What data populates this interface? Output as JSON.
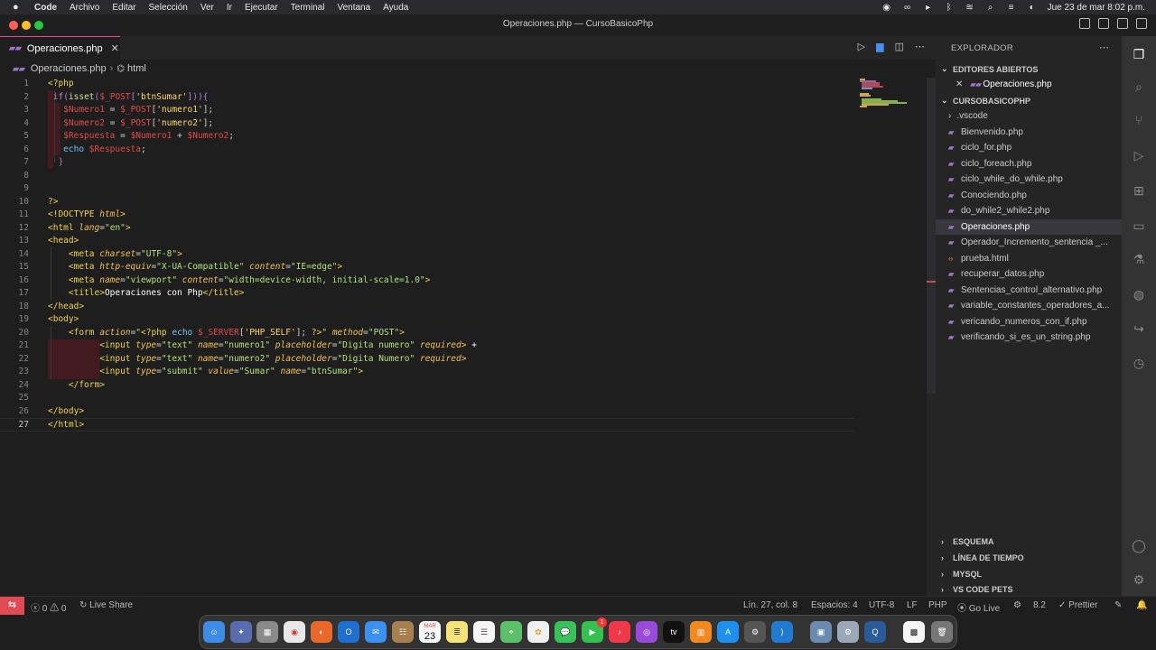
{
  "menubar": {
    "app": "Code",
    "items": [
      "Archivo",
      "Editar",
      "Selección",
      "Ver",
      "Ir",
      "Ejecutar",
      "Terminal",
      "Ventana",
      "Ayuda"
    ],
    "clock": "Jue 23 de mar  8:02 p.m."
  },
  "window": {
    "title": "Operaciones.php — CursoBasicoPhp"
  },
  "tab": {
    "label": "Operaciones.php",
    "close": "✕"
  },
  "breadcrumb": {
    "file": "Operaciones.php",
    "symbol": "html",
    "separator": "›"
  },
  "editor": {
    "current_line": 27,
    "lines": [
      {
        "n": "1"
      },
      {
        "n": "2"
      },
      {
        "n": "3"
      },
      {
        "n": "4"
      },
      {
        "n": "5"
      },
      {
        "n": "6"
      },
      {
        "n": "7"
      },
      {
        "n": "8"
      },
      {
        "n": "9"
      },
      {
        "n": "10"
      },
      {
        "n": "11"
      },
      {
        "n": "12"
      },
      {
        "n": "13"
      },
      {
        "n": "14"
      },
      {
        "n": "15"
      },
      {
        "n": "16"
      },
      {
        "n": "17"
      },
      {
        "n": "18"
      },
      {
        "n": "19"
      },
      {
        "n": "20"
      },
      {
        "n": "21"
      },
      {
        "n": "22"
      },
      {
        "n": "23"
      },
      {
        "n": "24"
      },
      {
        "n": "25"
      },
      {
        "n": "26"
      },
      {
        "n": "27"
      }
    ]
  },
  "explorer": {
    "title": "EXPLORADOR",
    "open_editors_label": "EDITORES ABIERTOS",
    "open_editor_file": "Operaciones.php",
    "folder_label": "CURSOBASICOPHP",
    "files": [
      {
        "name": ".vscode",
        "type": "folder"
      },
      {
        "name": "Bienvenido.php",
        "type": "php"
      },
      {
        "name": "ciclo_for.php",
        "type": "php"
      },
      {
        "name": "ciclo_foreach.php",
        "type": "php"
      },
      {
        "name": "ciclo_while_do_while.php",
        "type": "php"
      },
      {
        "name": "Conociendo.php",
        "type": "php"
      },
      {
        "name": "do_while2_while2.php",
        "type": "php"
      },
      {
        "name": "Operaciones.php",
        "type": "php",
        "selected": true
      },
      {
        "name": "Operador_Incremento_sentencia _...",
        "type": "php"
      },
      {
        "name": "prueba.html",
        "type": "html"
      },
      {
        "name": "recuperar_datos.php",
        "type": "php"
      },
      {
        "name": "Sentencias_control_alternativo.php",
        "type": "php"
      },
      {
        "name": "variable_constantes_operadores_a...",
        "type": "php"
      },
      {
        "name": "vericando_numeros_con_if.php",
        "type": "php"
      },
      {
        "name": "verificando_si_es_un_string.php",
        "type": "php"
      }
    ],
    "bottom_sections": [
      "ESQUEMA",
      "LÍNEA DE TIEMPO",
      "MYSQL",
      "VS CODE PETS"
    ]
  },
  "statusbar": {
    "errors": "0",
    "warnings": "0",
    "live_share": "Live Share",
    "position": "Lín. 27, col. 8",
    "spaces": "Espacios: 4",
    "encoding": "UTF-8",
    "eol": "LF",
    "language": "PHP",
    "go_live": "Go Live",
    "php_version": "8.2",
    "prettier": "Prettier"
  },
  "dock": {
    "calendar_month": "MAR",
    "calendar_day": "23",
    "facetime_badge": "1",
    "apps": [
      "finder-icon",
      "launchpad-icon",
      "chrome-icon",
      "firefox-icon",
      "outlook-icon",
      "mail-icon",
      "contacts-icon",
      "calendar-icon",
      "notes-icon",
      "reminders-icon",
      "maps-icon",
      "photos-icon",
      "messages-icon",
      "facetime-icon",
      "music-icon",
      "podcasts-icon",
      "tv-icon",
      "books-icon",
      "appstore-icon",
      "settings-icon",
      "vscode-icon",
      "preview-icon",
      "system-prefs-icon",
      "quicktime-icon",
      "qr-icon",
      "trash-icon"
    ]
  }
}
